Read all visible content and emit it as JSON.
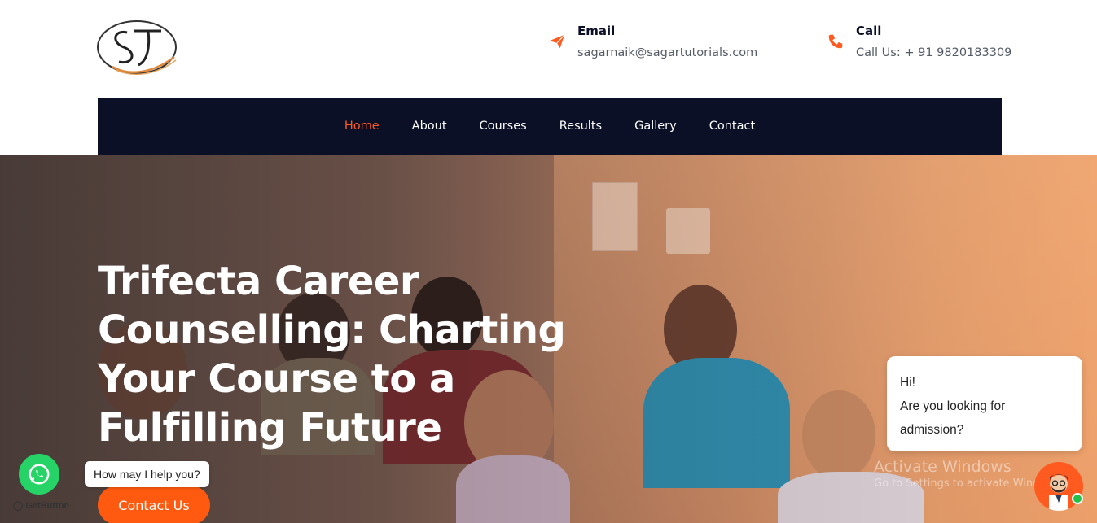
{
  "header": {
    "logo_text": "ST",
    "email": {
      "title": "Email",
      "value": "sagarnaik@sagartutorials.com",
      "icon": "paper-plane-icon"
    },
    "call": {
      "title": "Call",
      "value": "Call Us: + 91 9820183309",
      "icon": "phone-icon"
    }
  },
  "nav": {
    "items": [
      {
        "label": "Home",
        "active": true
      },
      {
        "label": "About"
      },
      {
        "label": "Courses"
      },
      {
        "label": "Results"
      },
      {
        "label": "Gallery"
      },
      {
        "label": "Contact"
      }
    ]
  },
  "hero": {
    "title": "Trifecta Career Counselling: Charting Your Course to a Fulfilling Future",
    "cta": "Contact Us"
  },
  "whatsapp": {
    "bubble": "How may I help you?",
    "brand": "GetButton"
  },
  "chat": {
    "line1": "Hi!",
    "line2": "Are you looking for admission?"
  },
  "watermark": {
    "line1": "Activate Windows",
    "line2": "Go to Settings to activate Windows."
  },
  "colors": {
    "accent": "#ff5a1f",
    "navy": "#0b1026",
    "whatsapp": "#25d366"
  }
}
